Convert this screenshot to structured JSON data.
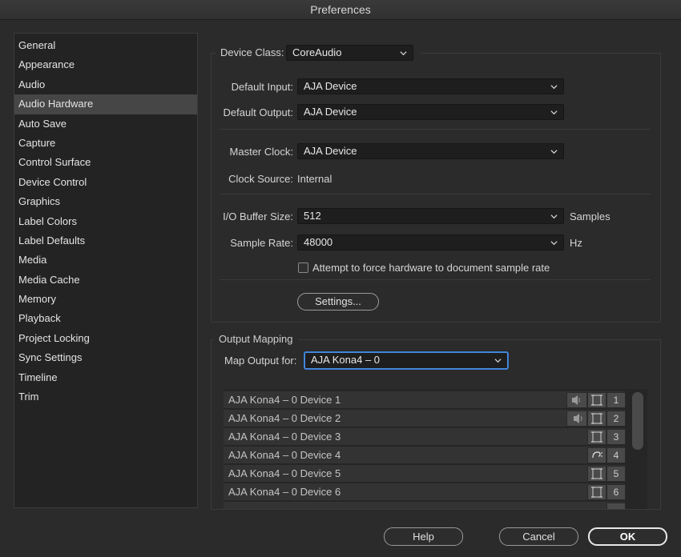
{
  "window": {
    "title": "Preferences"
  },
  "sidebar": {
    "items": [
      {
        "label": "General"
      },
      {
        "label": "Appearance"
      },
      {
        "label": "Audio"
      },
      {
        "label": "Audio Hardware"
      },
      {
        "label": "Auto Save"
      },
      {
        "label": "Capture"
      },
      {
        "label": "Control Surface"
      },
      {
        "label": "Device Control"
      },
      {
        "label": "Graphics"
      },
      {
        "label": "Label Colors"
      },
      {
        "label": "Label Defaults"
      },
      {
        "label": "Media"
      },
      {
        "label": "Media Cache"
      },
      {
        "label": "Memory"
      },
      {
        "label": "Playback"
      },
      {
        "label": "Project Locking"
      },
      {
        "label": "Sync Settings"
      },
      {
        "label": "Timeline"
      },
      {
        "label": "Trim"
      }
    ],
    "selected": "Audio Hardware"
  },
  "device": {
    "class_label": "Device Class:",
    "class_value": "CoreAudio",
    "default_input_label": "Default Input:",
    "default_input_value": "AJA Device",
    "default_output_label": "Default Output:",
    "default_output_value": "AJA Device",
    "master_clock_label": "Master Clock:",
    "master_clock_value": "AJA Device",
    "clock_source_label": "Clock Source:",
    "clock_source_value": "Internal",
    "buffer_label": "I/O Buffer Size:",
    "buffer_value": "512",
    "buffer_unit": "Samples",
    "sample_rate_label": "Sample Rate:",
    "sample_rate_value": "48000",
    "sample_rate_unit": "Hz",
    "force_rate_label": "Attempt to force hardware to document sample rate",
    "force_rate_checked": false,
    "settings_button": "Settings..."
  },
  "output_mapping": {
    "title": "Output Mapping",
    "map_label": "Map Output for:",
    "map_value": "AJA Kona4 – 0",
    "rows": [
      {
        "name": "AJA Kona4 – 0 Device 1",
        "channel": "1",
        "icons": [
          "speaker-left-icon",
          "surround-frame-icon"
        ]
      },
      {
        "name": "AJA Kona4 – 0 Device 2",
        "channel": "2",
        "icons": [
          "speaker-right-icon",
          "surround-frame-icon"
        ]
      },
      {
        "name": "AJA Kona4 – 0 Device 3",
        "channel": "3",
        "icons": [
          "surround-frame-icon"
        ]
      },
      {
        "name": "AJA Kona4 – 0 Device 4",
        "channel": "4",
        "icons": [
          "lfe-icon"
        ]
      },
      {
        "name": "AJA Kona4 – 0 Device 5",
        "channel": "5",
        "icons": [
          "surround-frame-icon"
        ]
      },
      {
        "name": "AJA Kona4 – 0 Device 6",
        "channel": "6",
        "icons": [
          "surround-frame-icon"
        ]
      }
    ]
  },
  "buttons": {
    "help": "Help",
    "cancel": "Cancel",
    "ok": "OK"
  },
  "colors": {
    "background": "#2b2b2b",
    "selected_item": "#464646",
    "focus": "#4a8fe0"
  }
}
